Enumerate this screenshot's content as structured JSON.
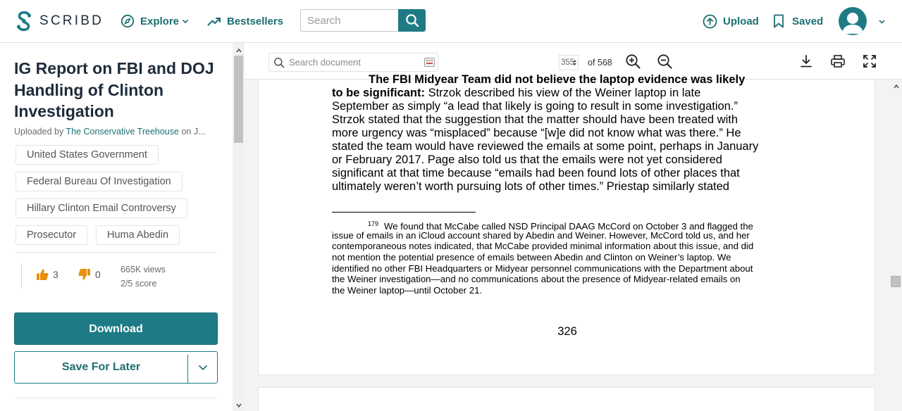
{
  "header": {
    "logo_text": "SCRIBD",
    "explore_label": "Explore",
    "bestsellers_label": "Bestsellers",
    "search_placeholder": "Search",
    "upload_label": "Upload",
    "saved_label": "Saved"
  },
  "sidebar": {
    "title": "IG Report on FBI and DOJ Handling of Clinton Investigation",
    "uploaded_prefix": "Uploaded by",
    "uploader": "The Conservative Treehouse",
    "uploaded_suffix": "on J...",
    "tags": [
      "United States Government",
      "Federal Bureau Of Investigation",
      "Hillary Clinton Email Controversy",
      "Prosecutor",
      "Huma Abedin"
    ],
    "upvotes": "3",
    "downvotes": "0",
    "views": "665K views",
    "score": "2/5 score",
    "download_label": "Download",
    "save_label": "Save For Later"
  },
  "viewer": {
    "search_placeholder": "Search document",
    "current_page": "355",
    "page_total": "of 568",
    "body_lines": [
      {
        "bold": "The FBI Midyear Team did not believe the laptop evidence was likely",
        "text": ""
      },
      {
        "bold": "to be significant:",
        "text": "  Strzok described his view of the Weiner laptop in late"
      },
      {
        "bold": "",
        "text": "September as simply “a lead that likely is going to result in some investigation.”"
      },
      {
        "bold": "",
        "text": "Strzok stated that the suggestion that the matter should have been treated with"
      },
      {
        "bold": "",
        "text": "more urgency was “misplaced” because “[w]e did not know what was there.”  He"
      },
      {
        "bold": "",
        "text": "stated the team would have reviewed the emails at some point, perhaps in January"
      },
      {
        "bold": "",
        "text": "or February 2017.  Page also told us that the emails were not yet considered"
      },
      {
        "bold": "",
        "text": "significant at that time because “emails had been found lots of other places that"
      },
      {
        "bold": "",
        "text": "ultimately weren’t worth pursuing lots of other times.”  Priestap similarly stated"
      }
    ],
    "footnote_number": "179",
    "footnote_lines": [
      "We found that McCabe called NSD Principal DAAG McCord on October 3 and flagged the",
      "issue of emails in an iCloud account shared by Abedin and Weiner.  However, McCord told us, and her",
      "contemporaneous notes indicated, that McCabe provided minimal information about this issue, and did",
      "not mention the potential presence of emails between Abedin and Clinton on Weiner’s laptop.  We",
      "identified no other FBI Headquarters or Midyear personnel communications with the Department about",
      "the Weiner investigation—and no communications about the presence of Midyear-related emails on",
      "the Weiner laptop—until October 21."
    ],
    "page_number": "326"
  },
  "colors": {
    "brand_teal": "#1e7b85",
    "link_teal": "#1c6f73",
    "vote_orange": "#e8900c"
  },
  "icons": {
    "logo": "scribd-logo-icon",
    "explore": "compass-icon",
    "bestsellers": "trending-up-icon",
    "search": "search-icon",
    "upload": "upload-icon",
    "saved": "bookmark-icon",
    "avatar": "user-avatar-icon",
    "thumbs_up": "thumbs-up-icon",
    "thumbs_down": "thumbs-down-icon",
    "zoom_in": "zoom-in-icon",
    "zoom_out": "zoom-out-icon",
    "download": "download-icon",
    "print": "print-icon",
    "fullscreen": "fullscreen-icon"
  }
}
